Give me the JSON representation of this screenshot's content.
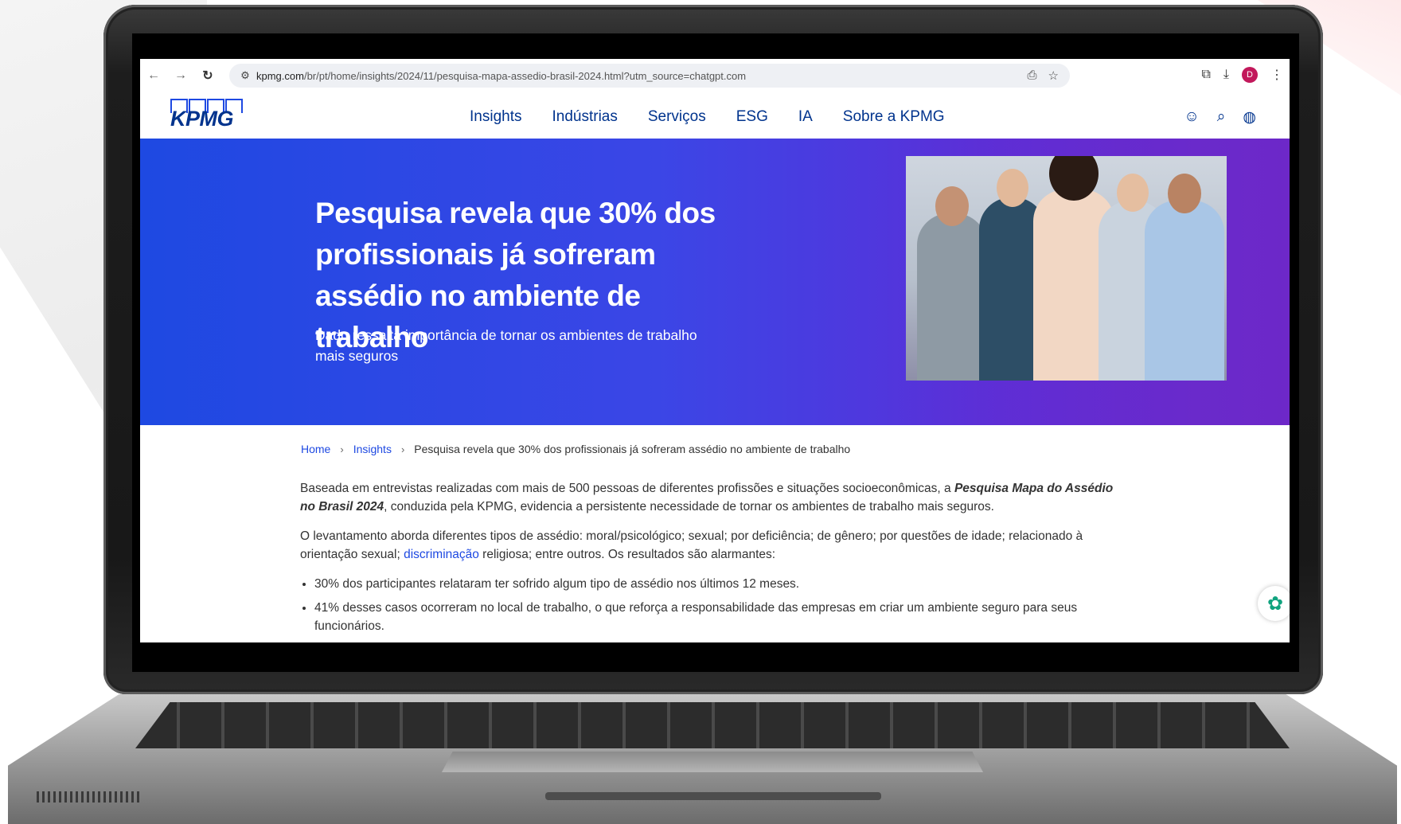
{
  "browser": {
    "url_host": "kpmg.com",
    "url_path": "/br/pt/home/insights/2024/11/pesquisa-mapa-assedio-brasil-2024.html?utm_source=chatgpt.com",
    "profile_initial": "D"
  },
  "site": {
    "logo_text": "KPMG",
    "nav": [
      "Insights",
      "Indústrias",
      "Serviços",
      "ESG",
      "IA",
      "Sobre a KPMG"
    ]
  },
  "hero": {
    "title": "Pesquisa revela que 30% dos profissionais já sofreram assédio no ambiente de trabalho",
    "subtitle": "Dado ressalta importância de tornar os ambientes de trabalho mais seguros",
    "background_color": "#1e49e2"
  },
  "breadcrumb": {
    "home": "Home",
    "insights": "Insights",
    "current": "Pesquisa revela que 30% dos profissionais já sofreram assédio no ambiente de trabalho"
  },
  "article": {
    "p1_before": "Baseada em entrevistas realizadas com mais de 500 pessoas de diferentes profissões e situações socioeconômicas, a ",
    "p1_emphasis": "Pesquisa Mapa do Assédio no Brasil 2024",
    "p1_after": ", conduzida pela KPMG, evidencia a persistente necessidade de tornar os ambientes de trabalho mais seguros.",
    "p2_before": "O levantamento aborda diferentes tipos de assédio: moral/psicológico; sexual; por deficiência; de gênero; por questões de idade; relacionado à orientação sexual; ",
    "p2_link": "discriminação",
    "p2_after": " religiosa; entre outros. Os resultados são alarmantes:",
    "bullets": [
      "30% dos participantes relataram ter sofrido algum tipo de assédio nos últimos 12 meses.",
      "41% desses casos ocorreram no local de trabalho, o que reforça a responsabilidade das empresas em criar um ambiente seguro para seus funcionários."
    ]
  },
  "icons": {
    "back": "arrow-left-icon",
    "forward": "arrow-right-icon",
    "reload": "reload-icon",
    "site_info": "site-info-icon",
    "install": "install-app-icon",
    "bookmark": "star-icon",
    "extensions": "puzzle-icon",
    "download": "download-icon",
    "menu": "kebab-menu-icon",
    "user": "user-icon",
    "search": "search-icon",
    "globe": "globe-icon",
    "chat": "chatgpt-icon"
  }
}
